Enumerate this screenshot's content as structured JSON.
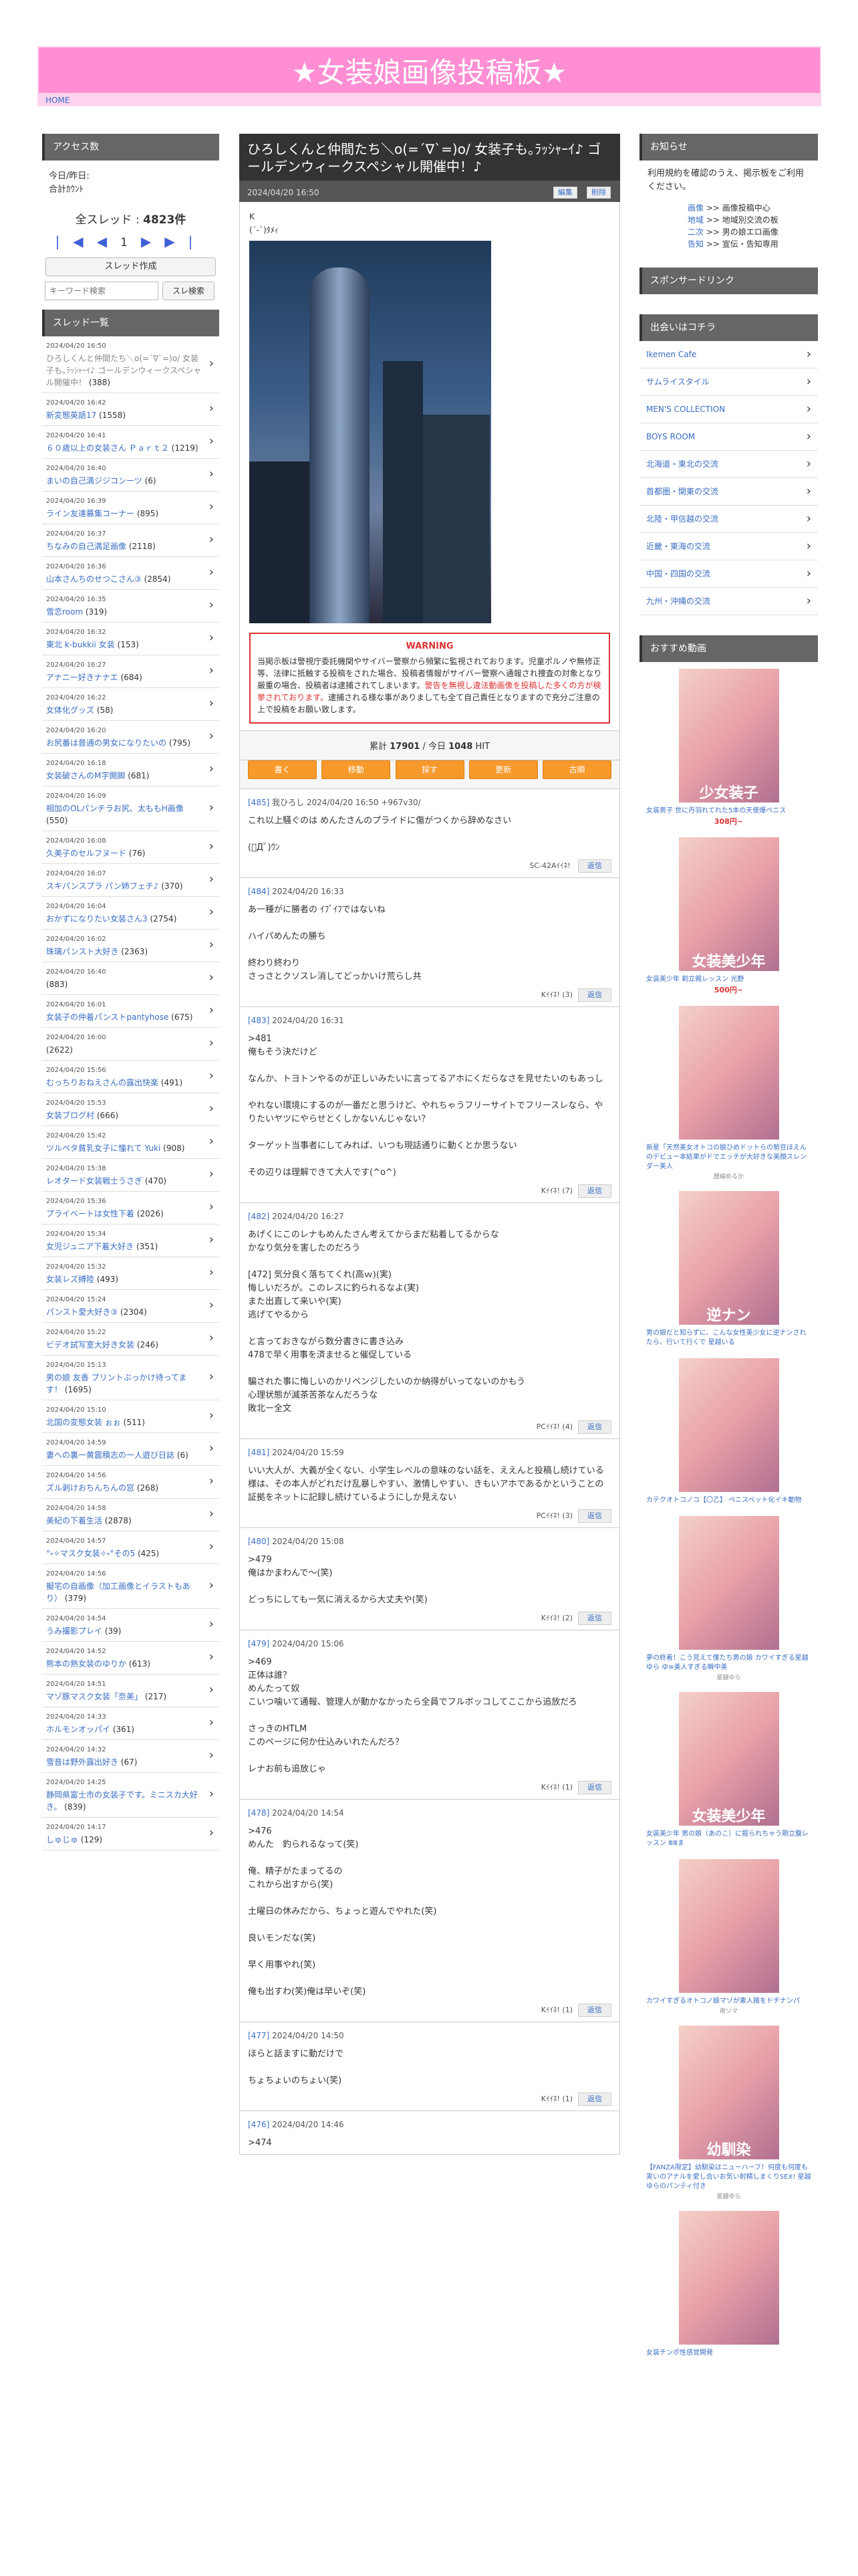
{
  "site": {
    "title": "★女装娘画像投稿板★",
    "home": "HOME"
  },
  "left": {
    "access_head": "アクセス数",
    "access_lines": [
      "今日/昨日:",
      "合計ｶｳﾝﾄ"
    ],
    "threads_label": "全スレッド :",
    "threads_count": "4823件",
    "pager": {
      "first": "|◀",
      "prev": "◀",
      "page": "1",
      "next": "▶",
      "last": "▶|"
    },
    "make_btn": "スレッド作成",
    "search_placeholder": "キーワード検索",
    "search_btn": "スレ検索",
    "list_head": "スレッド一覧",
    "threads": [
      {
        "d": "2024/04/20 16:50",
        "t": "ひろしくんと仲間たち＼o(=´∇`=)o/ 女装子も｡ﾗｯｼｬｰｲ♪ ゴールデンウィークスペシャル開催中！",
        "c": "(388)",
        "g": true
      },
      {
        "d": "2024/04/20 16:42",
        "t": "新変態英語17",
        "c": "(1558)"
      },
      {
        "d": "2024/04/20 16:41",
        "t": "６０歳以上の女装さん Ｐａｒｔ２",
        "c": "(1219)"
      },
      {
        "d": "2024/04/20 16:40",
        "t": "まいの自己満ジジコンーツ",
        "c": "(6)"
      },
      {
        "d": "2024/04/20 16:39",
        "t": "ライン友達募集コーナー",
        "c": "(895)"
      },
      {
        "d": "2024/04/20 16:37",
        "t": "ちなみの自己満足画像",
        "c": "(2118)"
      },
      {
        "d": "2024/04/20 16:36",
        "t": "山本さんちのせつこさん③",
        "c": "(2854)"
      },
      {
        "d": "2024/04/20 16:35",
        "t": "雪恋room",
        "c": "(319)"
      },
      {
        "d": "2024/04/20 16:32",
        "t": "東北 k-bukkii 女装",
        "c": "(153)"
      },
      {
        "d": "2024/04/20 16:27",
        "t": "アナニー好きナナエ",
        "c": "(684)"
      },
      {
        "d": "2024/04/20 16:22",
        "t": "女体化グッズ",
        "c": "(58)"
      },
      {
        "d": "2024/04/20 16:20",
        "t": "お尻番は普通の男女になりたいの",
        "c": "(795)"
      },
      {
        "d": "2024/04/20 16:18",
        "t": "女装破さんのM字開脚",
        "c": "(681)"
      },
      {
        "d": "2024/04/20 16:09",
        "t": "相加のOLパンチラお尻、太ももH画像",
        "c": "(550)"
      },
      {
        "d": "2024/04/20 16:08",
        "t": "久美子のセルフヌード",
        "c": "(76)"
      },
      {
        "d": "2024/04/20 16:07",
        "t": "スキパンスプラ パン姉フェチ♪",
        "c": "(370)"
      },
      {
        "d": "2024/04/20 16:04",
        "t": "おかずになりたい女装さん3",
        "c": "(2754)"
      },
      {
        "d": "2024/04/20 16:02",
        "t": "珠璃パンスト大好き",
        "c": "(2363)"
      },
      {
        "d": "2024/04/20 16:40",
        "t": "",
        "c": "(883)"
      },
      {
        "d": "2024/04/20 16:01",
        "t": "女装子の仲着パンストpantyhose",
        "c": "(675)"
      },
      {
        "d": "2024/04/20 16:00",
        "t": "",
        "c": "(2622)"
      },
      {
        "d": "2024/04/20 15:56",
        "t": "むっちりおねえさんの露出快楽",
        "c": "(491)"
      },
      {
        "d": "2024/04/20 15:53",
        "t": "女装ブログ村",
        "c": "(666)"
      },
      {
        "d": "2024/04/20 15:42",
        "t": "ツルペタ貧乳女子に憧れて Yuki",
        "c": "(908)"
      },
      {
        "d": "2024/04/20 15:38",
        "t": "レオタード女装戦士うさぎ",
        "c": "(470)"
      },
      {
        "d": "2024/04/20 15:36",
        "t": "プライベートは女性下着",
        "c": "(2026)"
      },
      {
        "d": "2024/04/20 15:34",
        "t": "女児ジュニア下着大好き",
        "c": "(351)"
      },
      {
        "d": "2024/04/20 15:32",
        "t": "女装レズ縛陸",
        "c": "(493)"
      },
      {
        "d": "2024/04/20 15:24",
        "t": "パンスト愛大好き③",
        "c": "(2304)"
      },
      {
        "d": "2024/04/20 15:22",
        "t": "ビデオ試写室大好き女装",
        "c": "(246)"
      },
      {
        "d": "2024/04/20 15:13",
        "t": "男の娘 友香 プリントぶっかけ待ってます！",
        "c": "(1695)"
      },
      {
        "d": "2024/04/20 15:10",
        "t": "北国の変態女装 ぉぉ",
        "c": "(511)"
      },
      {
        "d": "2024/04/20 14:59",
        "t": "妻への裏一黄震積志の一人遊び日誌",
        "c": "(6)"
      },
      {
        "d": "2024/04/20 14:56",
        "t": "ズル剥けおちんちんの窓",
        "c": "(268)"
      },
      {
        "d": "2024/04/20 14:58",
        "t": "美紀の下着生活",
        "c": "(2878)"
      },
      {
        "d": "2024/04/20 14:57",
        "t": "°˖✧マスク女装✧˖°その5",
        "c": "(425)"
      },
      {
        "d": "2024/04/20 14:56",
        "t": "擬宅の自画像（加工画像とイラストもあり）",
        "c": "(379)"
      },
      {
        "d": "2024/04/20 14:54",
        "t": "うみ撮影プレイ",
        "c": "(39)"
      },
      {
        "d": "2024/04/20 14:52",
        "t": "熊本の熟女装のゆりか",
        "c": "(613)"
      },
      {
        "d": "2024/04/20 14:51",
        "t": "マゾ豚マスク女装「奈美」",
        "c": "(217)"
      },
      {
        "d": "2024/04/20 14:33",
        "t": "ホルモンオッパイ",
        "c": "(361)"
      },
      {
        "d": "2024/04/20 14:32",
        "t": "雪音は野外露出好き",
        "c": "(67)"
      },
      {
        "d": "2024/04/20 14:25",
        "t": "静岡県富士市の女装子です。ミニスカ大好き。",
        "c": "(839)"
      },
      {
        "d": "2024/04/20 14:17",
        "t": "しゅじゅ",
        "c": "(129)"
      }
    ]
  },
  "post": {
    "title": "ひろしくんと仲間たち＼o(=´∇`=)o/ 女装子も｡ﾗｯｼｬｰｲ♪ ゴールデンウィークスペシャル開催中！♪",
    "date": "2024/04/20 16:50",
    "edit": "編集",
    "delete": "削除",
    "line1": "K",
    "line2": "(´-`)ﾀﾒｨ",
    "warn_title": "WARNING",
    "warn_body": "当掲示板は警視庁委託機関やサイバー警察から頻繁に監視されております。児童ポルノや無修正等、法律に抵触する投稿をされた場合、投稿者情報がサイバー警察へ通報され捜査の対象となり厳重の場合、投稿者は逮捕されてしまいます。",
    "warn_red": "警告を無視し違法動画像を投稿した多くの方が検挙されております。",
    "warn_tail": "逮捕される様な事がありましても全て自己責任となりますので充分ご注意の上で投稿をお願い致します。",
    "hits_label": "累計",
    "hits_total": "17901",
    "hits_sep": "/ 今日",
    "hits_today": "1048",
    "hits_unit": "HIT",
    "actions": [
      "書く",
      "移動",
      "探す",
      "更新",
      "古順"
    ]
  },
  "responses": [
    {
      "n": "[485]",
      "who": "我ひろし",
      "date": "2024/04/20 16:50",
      "extra": "+967v30/",
      "body": "これ以上騒ぐのは めんたさんのプライドに傷がつくから辞めなさい\n\n(ﾟДﾟ)ｳﾝ",
      "ft": "SC-42Aｲｲﾈ!",
      "cnt": "",
      "reply": "返信"
    },
    {
      "n": "[484]",
      "who": "",
      "date": "2024/04/20 16:33",
      "extra": "",
      "body": "あ一種がに勝者の ｲﾌﾞｲﾌではないね\n\nハイパめんたの勝ち\n\n終わり終わり\nさっさとクソスレ消してどっかいけ荒らし共",
      "ft": "Kｲｲﾈ!",
      "cnt": "(3)",
      "reply": "返信"
    },
    {
      "n": "[483]",
      "who": "",
      "date": "2024/04/20 16:31",
      "extra": "",
      "body": ">481\n俺もそう決だけど\n\nなんか、トヨトンやるのが正しいみたいに言ってるアホにくだらなさを見せたいのもあっし\n\nやれない環境にするのが一番だと思うけど、やれちゃうフリーサイトでフリースレなら、やりたいヤツにやらせとくしかないんじゃない？\n\nターゲット当事者にしてみれば、いつも現話通りに動くとか思うない\n\nその辺りは理解できて大人です(^o^)",
      "ft": "Kｲｲﾈ!",
      "cnt": "(7)",
      "reply": "返信"
    },
    {
      "n": "[482]",
      "who": "",
      "date": "2024/04/20 16:27",
      "extra": "",
      "body": "あげくにこのレナもめんたさん考えてからまだ粘着してるからな\nかなり気分を害したのだろう\n\n[472] 気分良く落ちてくれ(高ｗ)(実)\n悔しいだろが。このレスに釣られるなよ(実)\nまた出直して来いや(実)\n逃げてやるから\n\nと言っておきながら数分書きに書き込み\n478で早く用事を済ませると催促している\n\n騙された事に悔しいのかリベンジしたいのか納得がいってないのかもう\n心理状態が滅茶苦茶なんだろうな\n敗北ー全文",
      "ft": "PCｲｲﾈ!",
      "cnt": "(4)",
      "reply": "返信"
    },
    {
      "n": "[481]",
      "who": "",
      "date": "2024/04/20 15:59",
      "extra": "",
      "body": "いい大人が、大義が全くない、小学生レベルの意味のない話を、ええんと投稿し続けている様は、その本人がどれだけ乱暴しやすい、激情しやすい、きもいアホであるかということの証拠をネットに記録し続けているようにしか見えない",
      "ft": "PCｲｲﾈ!",
      "cnt": "(3)",
      "reply": "返信"
    },
    {
      "n": "[480]",
      "who": "",
      "date": "2024/04/20 15:08",
      "extra": "",
      "body": ">479\n俺はかまわんで〜(笑)\n\nどっちにしても一気に消えるから大丈夫や(笑)",
      "ft": "Kｲｲﾈ!",
      "cnt": "(2)",
      "reply": "返信"
    },
    {
      "n": "[479]",
      "who": "",
      "date": "2024/04/20 15:06",
      "extra": "",
      "body": ">469\n正体は誰？\nめんたって奴\nこいつ噛いて通報、管理人が動かなかったら全員でフルボッコしてここから追放だろ\n\nさっきのHTLM\nこのページに何か仕込みいれたんだろ？\n\nレナお前も追放じゃ",
      "ft": "Kｲｲﾈ!",
      "cnt": "(1)",
      "reply": "返信"
    },
    {
      "n": "[478]",
      "who": "",
      "date": "2024/04/20 14:54",
      "extra": "",
      "body": ">476\nめんた　釣られるなって(笑)\n\n俺、精子がたまってるの\nこれから出すから(笑)\n\n土曜日の休みだから、ちょっと遊んでやれた(笑)\n\n良いモンだな(笑)\n\n早く用事やれ(笑)\n\n俺も出すわ(笑)俺は早いぞ(笑)",
      "ft": "Kｲｲﾈ!",
      "cnt": "(1)",
      "reply": "返信"
    },
    {
      "n": "[477]",
      "who": "",
      "date": "2024/04/20 14:50",
      "extra": "",
      "body": "ほらと話ますに動だけで\n\nちょちょいのちょい(笑)",
      "ft": "Kｲｲﾈ!",
      "cnt": "(1)",
      "reply": "返信"
    },
    {
      "n": "[476]",
      "who": "",
      "date": "2024/04/20 14:46",
      "extra": "",
      "body": ">474",
      "ft": "",
      "cnt": "",
      "reply": ""
    }
  ],
  "right": {
    "notice_head": "お知らせ",
    "notice_text": "利用規約を確認のうえ、掲示板をご利用ください。",
    "notice_links": [
      {
        "k": "画像",
        "v": ">> 画像投稿中心"
      },
      {
        "k": "地域",
        "v": ">> 地域別交流の板"
      },
      {
        "k": "二次",
        "v": ">> 男の娘エロ画像"
      },
      {
        "k": "告知",
        "v": ">> 宣伝・告知専用"
      }
    ],
    "sponsor_head": "スポンサードリンク",
    "meet_head": "出会いはコチラ",
    "meet": [
      "Ikemen Cafe",
      "サムライスタイル",
      "MEN'S COLLECTION",
      "BOYS ROOM",
      "北海道・東北の交流",
      "首都圏・関東の交流",
      "北陸・甲信越の交流",
      "近畿・東海の交流",
      "中国・四国の交流",
      "九州・沖縄の交流"
    ],
    "dvd_head": "おすすめ動画",
    "dvds": [
      {
        "cap": "少女装子",
        "t": "女装男子 世に丹羽れてれた5本の天使爆ペニス",
        "p": "308円~",
        "s": ""
      },
      {
        "cap": "女装美少年",
        "t": "女装美少年 剃立親レッスン 光野",
        "p": "500円~",
        "s": ""
      },
      {
        "cap": "",
        "t": "新星「天然美女オトコの娘ひめドットらの勢豆ほえんのデビュー本結果がドでエッチが大好きな美顔スレンダー美人",
        "p": "",
        "s": "歴線めるか"
      },
      {
        "cap": "逆ナン",
        "t": "男の娘だと知らずに、こんな女性美少女に逆ナンされたら、行いて行くで 星越いる",
        "p": "",
        "s": ""
      },
      {
        "cap": "",
        "t": "カテクオトコノコ【〇乙】 ペニスペット化イキ動物",
        "p": "",
        "s": ""
      },
      {
        "cap": "",
        "t": "夢の終着！こう見えて僕たち男の娘 カワイすぎる星越ゆら ゆ≡美人すぎる瞬中美",
        "p": "",
        "s": "星越ゆら"
      },
      {
        "cap": "女装美少年",
        "t": "女装美少年 男の娘（あのこ）に掘られちゃう剛立腹レッスン ⅢⅢま",
        "p": "",
        "s": ""
      },
      {
        "cap": "",
        "t": "カワイすぎるオトコノ娘マゾが素人雑をドチナンパ",
        "p": "",
        "s": "雨ソマ"
      },
      {
        "cap": "幼馴染",
        "t": "【FANZA限定】幼馴染はニューハーフ！何度も何度も実いのアナルを愛し合いお気い射精しまくりSEX! 星越ゆらのパンティ付き",
        "p": "",
        "s": "星越ゆら"
      },
      {
        "cap": "",
        "t": "女装チンポ性感覚開発",
        "p": "",
        "s": ""
      }
    ]
  }
}
